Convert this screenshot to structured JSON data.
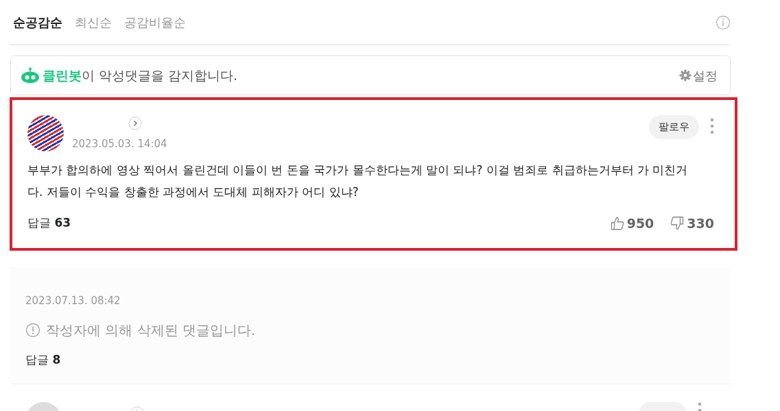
{
  "sort_tabs": [
    {
      "label": "순공감순",
      "selected": true
    },
    {
      "label": "최신순",
      "selected": false
    },
    {
      "label": "공감비율순",
      "selected": false
    }
  ],
  "cleanbot": {
    "brand": "클린봇",
    "message": "이 악성댓글을 감지합니다.",
    "settings": "설정"
  },
  "comments": [
    {
      "kind": "normal",
      "highlighted": true,
      "date": "2023.05.03. 14:04",
      "follow": "팔로우",
      "body": "부부가 합의하에 영상 찍어서 올린건데 이들이 번 돈을 국가가 몰수한다는게 말이 되냐? 이걸 범죄로 취급하는거부터 가 미친거다. 저들이 수익을 창출한 과정에서 도대체 피해자가 어디 있냐?",
      "reply_label": "답글",
      "reply_count": "63",
      "likes": "950",
      "dislikes": "330"
    },
    {
      "kind": "deleted",
      "date": "2023.07.13. 08:42",
      "body": "작성자에 의해 삭제된 댓글입니다.",
      "reply_label": "답글",
      "reply_count": "8"
    },
    {
      "kind": "partial"
    }
  ]
}
